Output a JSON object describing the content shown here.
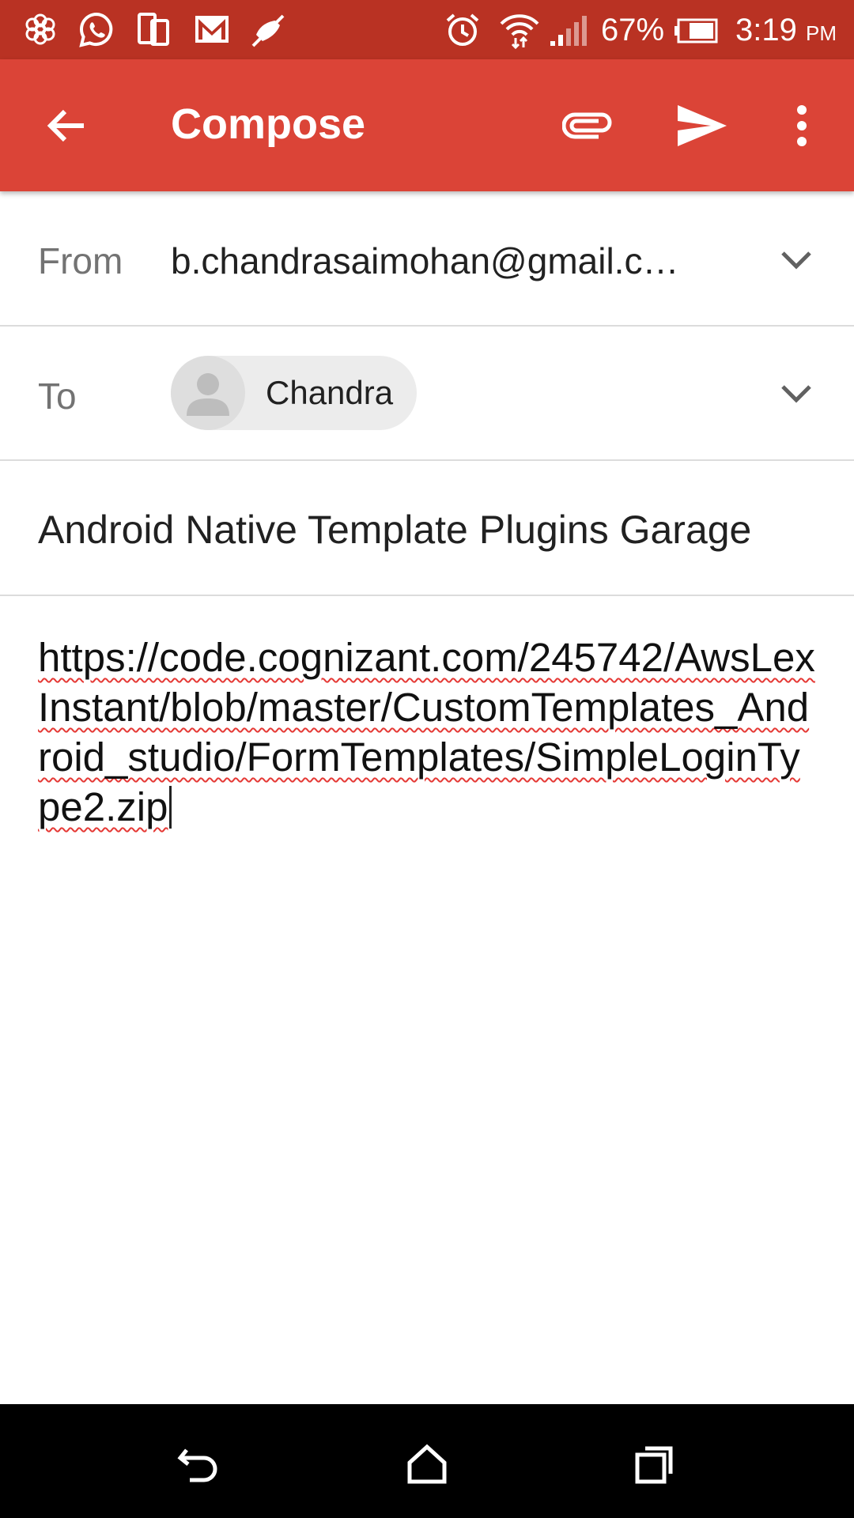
{
  "status_bar": {
    "battery_percent": "67%",
    "time": "3:19",
    "ampm": "PM",
    "icons": [
      "flower-icon",
      "whatsapp-icon",
      "phone-tablet-icon",
      "gmail-icon",
      "muted-icon",
      "alarm-icon",
      "wifi-icon",
      "signal-icon",
      "battery-icon"
    ]
  },
  "app_bar": {
    "title": "Compose",
    "icons": [
      "back-arrow-icon",
      "attach-icon",
      "send-icon",
      "more-vert-icon"
    ]
  },
  "from": {
    "label": "From",
    "value": "b.chandrasaimohan@gmail.c…"
  },
  "to": {
    "label": "To",
    "recipient": "Chandra"
  },
  "subject": "Android Native Template Plugins Garage",
  "body": "https://code.cognizant.com/245742/AwsLexInstant/blob/master/CustomTemplates_Android_studio/FormTemplates/SimpleLoginType2.zip",
  "colors": {
    "status_bar": "#b93223",
    "app_bar": "#db4437",
    "spell_underline": "#e53935"
  },
  "nav_bar": {
    "icons": [
      "back-icon",
      "home-icon",
      "recents-icon"
    ]
  }
}
